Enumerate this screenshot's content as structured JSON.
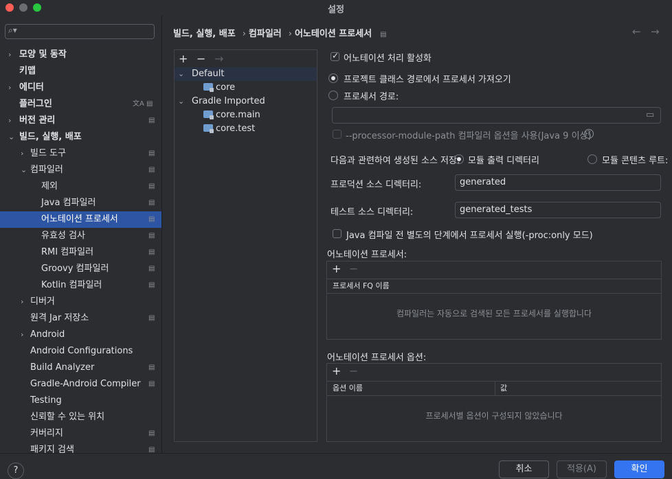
{
  "window": {
    "title": "설정",
    "traffic_colors": [
      "#ff5f57",
      "#febc2e",
      "#28c840"
    ]
  },
  "sidebar": {
    "search": {
      "placeholder": "",
      "value": ""
    },
    "items": [
      {
        "label": "모양 및 동작",
        "chevron": "›",
        "bold": true
      },
      {
        "label": "키맵",
        "chevron": "",
        "bold": true
      },
      {
        "label": "에디터",
        "chevron": "›",
        "bold": true
      },
      {
        "label": "플러그인",
        "chevron": "",
        "bold": true,
        "badge": "文A ▤"
      },
      {
        "label": "버전 관리",
        "chevron": "›",
        "bold": true,
        "badge": "▤"
      },
      {
        "label": "빌드, 실행, 배포",
        "chevron": "⌄",
        "bold": true
      },
      {
        "label": "빌드 도구",
        "chevron": "›",
        "badge": "▤"
      },
      {
        "label": "컴파일러",
        "chevron": "⌄",
        "badge": "▤"
      },
      {
        "label": "제외",
        "badge": "▤"
      },
      {
        "label": "Java 컴파일러",
        "badge": "▤"
      },
      {
        "label": "어노테이션 프로세서",
        "badge": "▤",
        "selected": true
      },
      {
        "label": "유효성 검사",
        "badge": "▤"
      },
      {
        "label": "RMI 컴파일러",
        "badge": "▤"
      },
      {
        "label": "Groovy 컴파일러",
        "badge": "▤"
      },
      {
        "label": "Kotlin 컴파일러",
        "badge": "▤"
      },
      {
        "label": "디버거",
        "chevron": "›"
      },
      {
        "label": "원격 Jar 저장소",
        "badge": "▤"
      },
      {
        "label": "Android",
        "chevron": "›"
      },
      {
        "label": "Android Configurations"
      },
      {
        "label": "Build Analyzer",
        "badge": "▤"
      },
      {
        "label": "Gradle-Android Compiler",
        "badge": "▤"
      },
      {
        "label": "Testing"
      },
      {
        "label": "신뢰할 수 있는 위치"
      },
      {
        "label": "커버리지",
        "badge": "▤"
      },
      {
        "label": "패키지 검색",
        "badge": "▤"
      }
    ]
  },
  "breadcrumb": {
    "parts": [
      "빌드, 실행, 배포",
      "컴파일러",
      "어노테이션 프로세서"
    ],
    "separator": "›",
    "icon": "▤"
  },
  "nav": {
    "back": "←",
    "forward": "→"
  },
  "profiles": {
    "toolbar": {
      "add": "+",
      "remove": "−",
      "move": "→"
    },
    "tree": [
      {
        "label": "Default",
        "chevron": "⌄",
        "selected": true
      },
      {
        "label": "core",
        "folder": true
      },
      {
        "label": "Gradle Imported",
        "chevron": "⌄"
      },
      {
        "label": "core.main",
        "folder": true
      },
      {
        "label": "core.test",
        "folder": true
      }
    ]
  },
  "settings": {
    "enable_processing": {
      "label": "어노테이션 처리 활성화",
      "checked": true
    },
    "obtain_from_classpath": {
      "label": "프로젝트 클래스 경로에서 프로세서 가져오기",
      "selected": true
    },
    "processor_path": {
      "label": "프로세서 경로:",
      "selected": false,
      "value": ""
    },
    "module_path_option": {
      "label": "--processor-module-path 컴파일러 옵션을 사용(Java 9 이상)",
      "checked": false,
      "help": "?"
    },
    "store_generated": {
      "label": "다음과 관련하여 생성된 소스 저장:",
      "option_output": "모듈 출력 디렉터리",
      "option_content_root": "모듈 콘텐츠 루트:"
    },
    "production_dir": {
      "label": "프로덕션 소스 디렉터리:",
      "value": "generated"
    },
    "test_dir": {
      "label": "테스트 소스 디렉터리:",
      "value": "generated_tests"
    },
    "separate_step": {
      "label": "Java 컴파일 전 별도의 단계에서 프로세서 실행(-proc:only 모드)",
      "checked": false
    }
  },
  "processors_table": {
    "title": "어노테이션 프로세서:",
    "add": "+",
    "remove": "−",
    "column": "프로세서 FQ 이름",
    "empty": "컴파일러는 자동으로 검색된 모든 프로세서를 실행합니다"
  },
  "options_table": {
    "title": "어노테이션 프로세서 옵션:",
    "add": "+",
    "remove": "−",
    "columns": [
      "옵션 이름",
      "값"
    ],
    "empty": "프로세서별 옵션이 구성되지 않았습니다"
  },
  "footer": {
    "help": "?",
    "cancel": "취소",
    "apply": "적용(A)",
    "ok": "확인"
  },
  "colors": {
    "accent": "#2e55a3",
    "ok_button": "#3574f0",
    "background": "#2b2d30"
  }
}
